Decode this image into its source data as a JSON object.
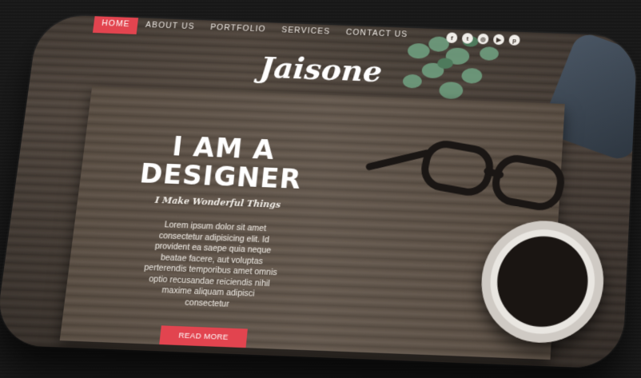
{
  "nav": {
    "items": [
      {
        "label": "HOME",
        "active": true
      },
      {
        "label": "ABOUT US",
        "active": false
      },
      {
        "label": "PORTFOLIO",
        "active": false
      },
      {
        "label": "SERVICES",
        "active": false
      },
      {
        "label": "CONTACT US",
        "active": false
      }
    ]
  },
  "social": {
    "icons": [
      {
        "name": "facebook-icon",
        "glyph": "f"
      },
      {
        "name": "twitter-icon",
        "glyph": "t"
      },
      {
        "name": "instagram-icon",
        "glyph": "◎"
      },
      {
        "name": "youtube-icon",
        "glyph": "▶"
      },
      {
        "name": "pinterest-icon",
        "glyph": "p"
      }
    ]
  },
  "brand": {
    "name": "Jaisone"
  },
  "hero": {
    "title_line1": "I AM A",
    "title_line2": "DESIGNER",
    "tagline": "I Make Wonderful Things",
    "body": "Lorem ipsum dolor sit amet consectetur adipisicing elit. Id provident ea saepe quia neque beatae facere, aut voluptas perterendis temporibus amet omnis optio recusandae reiciendis nihil maxime aliquam adipisci consectetur",
    "button_label": "READ MORE"
  },
  "colors": {
    "accent": "#e2444f",
    "wood": "#5a4e43",
    "text": "#ffffff"
  }
}
